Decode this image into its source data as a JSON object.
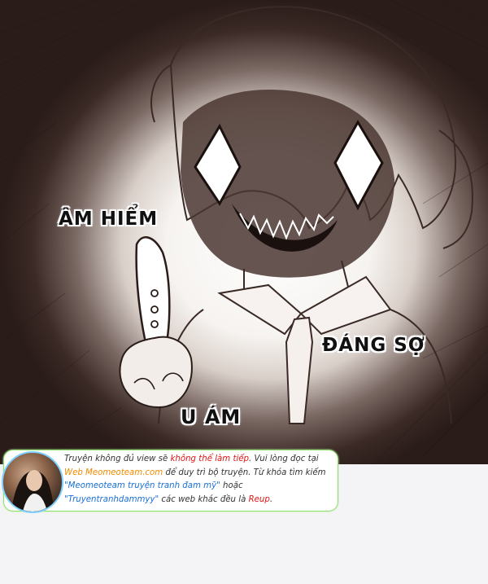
{
  "sfx": {
    "sneaky": "ÂM HIỂM",
    "scary": "ĐÁNG SỢ",
    "gloomy": "U ÁM"
  },
  "notice": {
    "line1": {
      "a": "Truyện không đủ view sẽ ",
      "b": "không thể làm tiếp",
      "c": ". Vui lòng đọc tại"
    },
    "line2": {
      "a": "Web Meomeoteam.com",
      "b": " để duy trì bộ truyện. Từ khóa tìm kiếm"
    },
    "line3": {
      "a": "\"Meomeoteam truyện tranh đam mỹ\"",
      "b": " hoặc"
    },
    "line4": {
      "a": "\"Truyentranhdammyy\"",
      "b": " các web khác đều là ",
      "c": "Reup",
      "d": "."
    }
  },
  "colors": {
    "warning": "#e01515",
    "site": "#f28a00",
    "keyword": "#1a6fd6",
    "border": "#8fe06a"
  }
}
